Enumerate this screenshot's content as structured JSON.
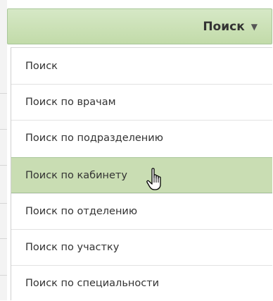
{
  "search_button": {
    "label": "Поиск",
    "caret_icon": "caret-down-icon"
  },
  "menu": {
    "items": [
      {
        "label": "Поиск"
      },
      {
        "label": "Поиск по врачам"
      },
      {
        "label": "Поиск по подразделению"
      },
      {
        "label": "Поиск по кабинету",
        "state": "hovered"
      },
      {
        "label": "Поиск по отделению"
      },
      {
        "label": "Поиск по участку"
      },
      {
        "label": "Поиск по специальности"
      }
    ]
  },
  "cursor": {
    "icon": "hand-pointer-icon"
  },
  "colors": {
    "accent_green": "#c2dba9",
    "hover_green": "#c9ddb3",
    "text": "#333333"
  }
}
